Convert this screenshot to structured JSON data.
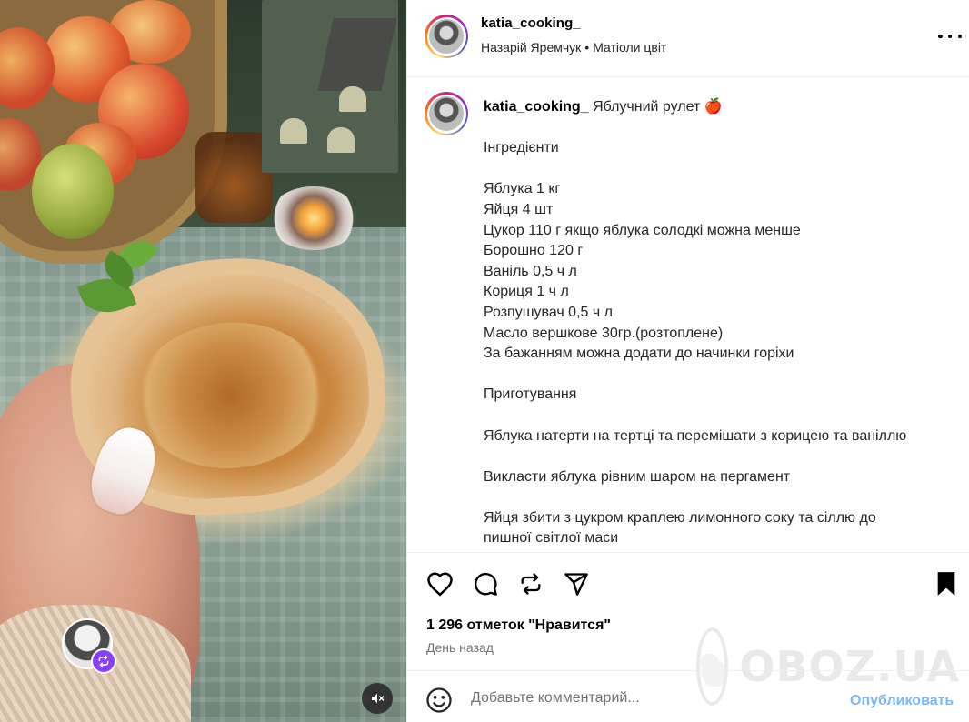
{
  "post": {
    "username": "katia_cooking_",
    "location_user": "Назарій Яремчук",
    "separator": "•",
    "audio": "Матіоли цвіт",
    "caption_title": "Яблучний рулет 🍎",
    "caption_lines": [
      "",
      "Інгредієнти",
      "",
      "Яблука 1 кг",
      "Яйця 4 шт",
      "Цукор 110 г якщо яблука солодкі можна менше",
      "Борошно 120 г",
      "Ваніль 0,5 ч л",
      "Кориця 1 ч л",
      "Розпушувач 0,5 ч л",
      "Масло вершкове 30гр.(розтоплене)",
      "За бажанням можна додати до начинки горіхи",
      "",
      "Приготування",
      "",
      "Яблука натерти на тертці та перемішати з корицею та ваніллю",
      "",
      "Викласти яблука рівним шаром на пергамент",
      "",
      "Яйця збити з цукром краплею лимонного соку та сіллю до",
      "пишної світлої маси"
    ],
    "likes": "1 296 отметок \"Нравится\"",
    "time": "День назад"
  },
  "comment": {
    "placeholder": "Добавьте комментарий...",
    "post_label": "Опубликовать"
  },
  "watermark": "OBOZ.UA",
  "icons": {
    "like": "heart-icon",
    "comment": "comment-icon",
    "share": "repost-icon",
    "send": "send-icon",
    "save": "bookmark-icon",
    "more": "more-icon",
    "emoji": "emoji-icon",
    "mute": "muted-speaker-icon",
    "repost_badge": "repost-icon"
  },
  "colors": {
    "post_button": "#7fb6f8",
    "repost_badge": "#8a3ffc",
    "divider": "#efefef",
    "secondary_text": "#737373"
  }
}
